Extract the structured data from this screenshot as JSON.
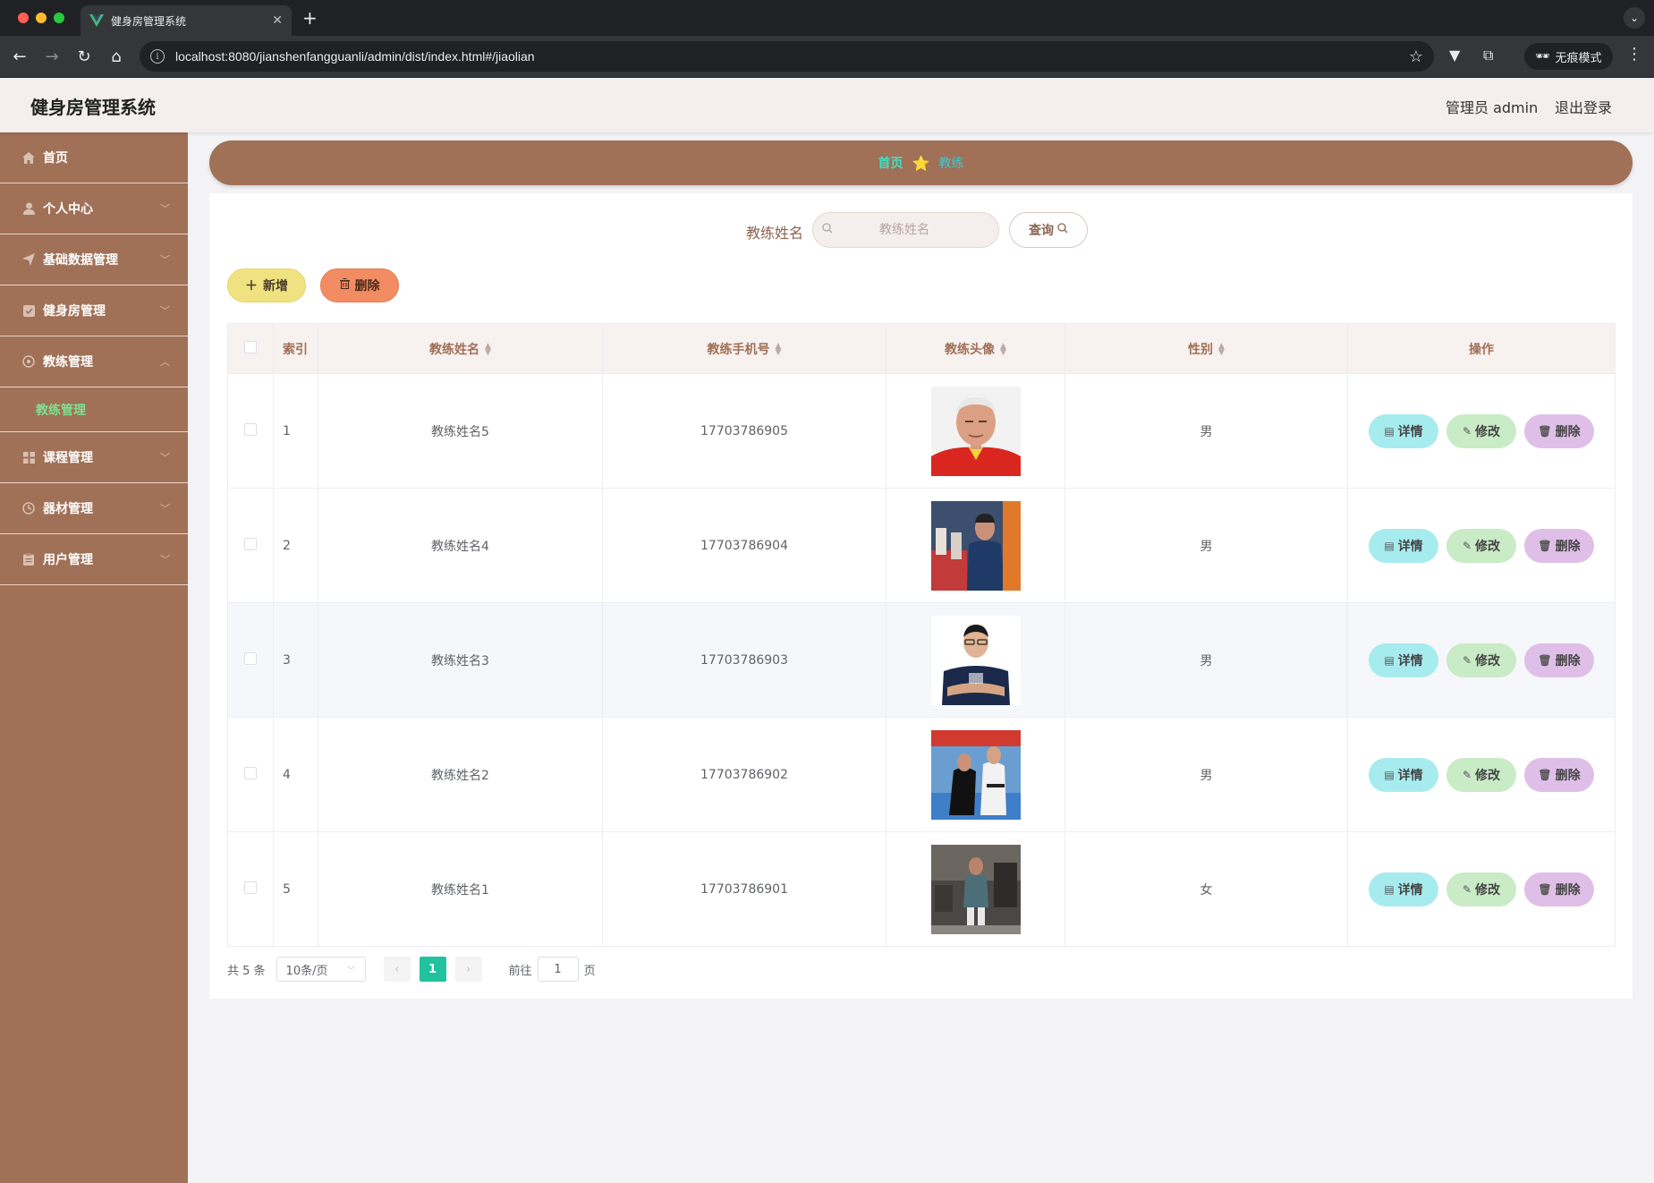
{
  "browser": {
    "tab_title": "健身房管理系统",
    "url": "localhost:8080/jianshenfangguanli/admin/dist/index.html#/jiaolian",
    "incognito_label": "无痕模式"
  },
  "header": {
    "title": "健身房管理系统",
    "admin_label": "管理员 admin",
    "logout_label": "退出登录"
  },
  "sidebar": {
    "items": [
      {
        "label": "首页",
        "icon": "home-icon"
      },
      {
        "label": "个人中心",
        "icon": "user-icon"
      },
      {
        "label": "基础数据管理",
        "icon": "send-icon"
      },
      {
        "label": "健身房管理",
        "icon": "checkbox-icon"
      },
      {
        "label": "教练管理",
        "icon": "settings-icon"
      },
      {
        "label": "课程管理",
        "icon": "grid-icon"
      },
      {
        "label": "器材管理",
        "icon": "clock-icon"
      },
      {
        "label": "用户管理",
        "icon": "clipboard-icon"
      }
    ],
    "active_sub": "教练管理"
  },
  "breadcrumb": {
    "home": "首页",
    "current": "教练"
  },
  "search": {
    "label": "教练姓名",
    "placeholder": "教练姓名",
    "button_label": "查询"
  },
  "actions": {
    "add_label": "新增",
    "delete_label": "删除"
  },
  "table": {
    "columns": [
      "索引",
      "教练姓名",
      "教练手机号",
      "教练头像",
      "性别",
      "操作"
    ],
    "rows": [
      {
        "index": "1",
        "name": "教练姓名5",
        "phone": "17703786905",
        "gender": "男"
      },
      {
        "index": "2",
        "name": "教练姓名4",
        "phone": "17703786904",
        "gender": "男"
      },
      {
        "index": "3",
        "name": "教练姓名3",
        "phone": "17703786903",
        "gender": "男"
      },
      {
        "index": "4",
        "name": "教练姓名2",
        "phone": "17703786902",
        "gender": "男"
      },
      {
        "index": "5",
        "name": "教练姓名1",
        "phone": "17703786901",
        "gender": "女"
      }
    ],
    "ops": {
      "detail": "详情",
      "edit": "修改",
      "delete": "删除"
    }
  },
  "pagination": {
    "total": "共 5 条",
    "page_size": "10条/页",
    "current_page": "1",
    "goto_label": "前往",
    "goto_value": "1",
    "goto_suffix": "页"
  }
}
